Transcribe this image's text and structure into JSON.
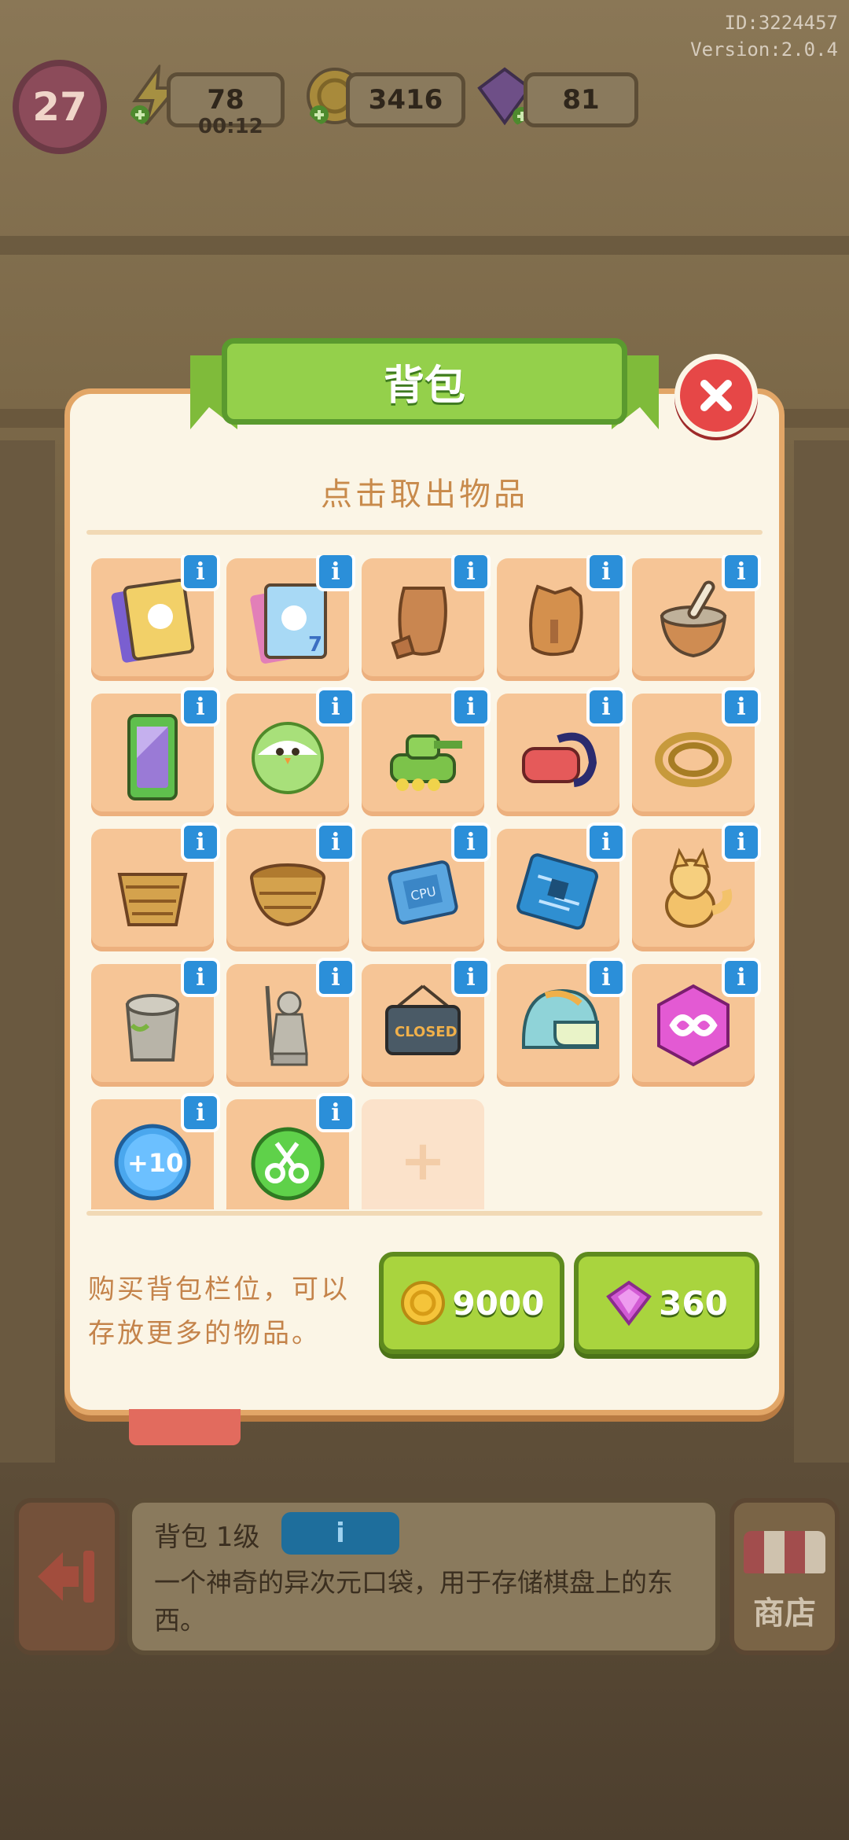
{
  "hud": {
    "level": "27",
    "energy": "78",
    "energy_timer": "00:12",
    "coins": "3416",
    "gems": "81",
    "id_text": "ID:3224457",
    "version_text": "Version:2.0.4"
  },
  "dialog": {
    "title": "背包",
    "subtitle": "点击取出物品",
    "info_glyph": "i",
    "add_glyph": "+",
    "items": [
      {
        "icon": "card-pack-icon"
      },
      {
        "icon": "card-pack-7-icon"
      },
      {
        "icon": "broken-clay-pot-icon"
      },
      {
        "icon": "broken-clay-jar-icon"
      },
      {
        "icon": "mortar-pestle-icon"
      },
      {
        "icon": "wardrobe-mirror-icon"
      },
      {
        "icon": "chick-egg-icon"
      },
      {
        "icon": "toy-tank-icon"
      },
      {
        "icon": "vr-headset-icon"
      },
      {
        "icon": "rope-coil-icon"
      },
      {
        "icon": "broken-basket-icon"
      },
      {
        "icon": "woven-basket-icon"
      },
      {
        "icon": "cpu-chip-icon"
      },
      {
        "icon": "circuit-board-icon"
      },
      {
        "icon": "fox-plush-icon"
      },
      {
        "icon": "stone-stump-icon"
      },
      {
        "icon": "warrior-statue-icon"
      },
      {
        "icon": "closed-sign-icon"
      },
      {
        "icon": "helmet-icon"
      },
      {
        "icon": "infinity-hexagon-icon"
      },
      {
        "icon": "plus-ten-coin-icon"
      },
      {
        "icon": "scissors-orb-icon"
      }
    ],
    "buy_text_line1": "购买背包栏位，可以",
    "buy_text_line2": "存放更多的物品。",
    "buy_coin_price": "9000",
    "buy_gem_price": "360"
  },
  "bottom_panel": {
    "title": "背包 1级",
    "badge_glyph": "i",
    "description": "一个神奇的异次元口袋，用于存储棋盘上的东西。",
    "shop_label": "商店"
  },
  "colors": {
    "panel_bg": "#fbf5e6",
    "panel_border": "#e2a667",
    "ribbon_green": "#94d04b",
    "cell_bg": "#f6c596",
    "info_blue": "#2b8fd9",
    "buy_green": "#a9d43e",
    "close_red": "#e64747"
  }
}
